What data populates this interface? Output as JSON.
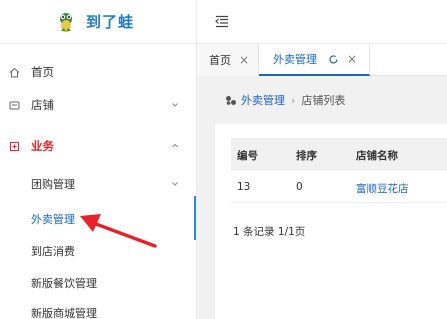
{
  "app": {
    "title": "到了蛙"
  },
  "sidebar": {
    "home": "首页",
    "store": "店铺",
    "business": "业务",
    "sub": {
      "group": "团购管理",
      "takeout": "外卖管理",
      "instore": "到店消费",
      "newdining": "新版餐饮管理",
      "newmall": "新版商城管理"
    }
  },
  "tabs": [
    {
      "label": "首页",
      "close": "×"
    },
    {
      "label": "外卖管理",
      "close": "×"
    }
  ],
  "breadcrumb": {
    "parent": "外卖管理",
    "separator": "›",
    "current": "店铺列表"
  },
  "table": {
    "headers": [
      "编号",
      "排序",
      "店铺名称"
    ],
    "rows": [
      [
        "13",
        "0",
        "富顺豆花店"
      ]
    ]
  },
  "pagination": {
    "summary": "1 条记录 1/1页"
  },
  "colors": {
    "accent": "#1a64c8",
    "section": "#e2272d",
    "annotation_arrow": "#e8202a"
  },
  "icons": {
    "logo": "frog-logo-icon",
    "home": "home-icon",
    "store": "store-icon",
    "business": "business-icon",
    "fold": "menu-fold-icon",
    "refresh": "refresh-icon",
    "crumb": "link-icon"
  }
}
